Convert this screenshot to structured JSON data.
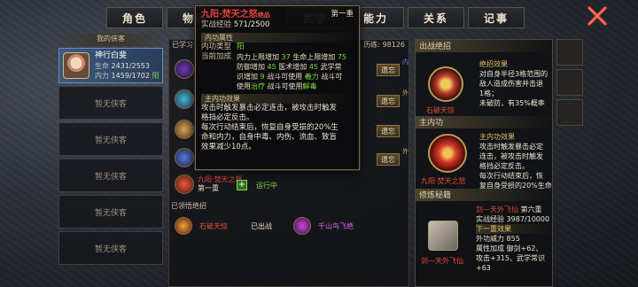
{
  "tabs": [
    "角色",
    "物品",
    "武学",
    "能力",
    "关系",
    "记事"
  ],
  "left": {
    "title": "我的侠客",
    "active_char": {
      "name": "神行白斐",
      "hp_label": "生命",
      "hp_value": "2431/2553",
      "mp_label": "内力",
      "mp_value": "1459/1702",
      "mp_tag": "阳"
    },
    "empty_slot": "暂无侠客",
    "empty_count": 5
  },
  "mid": {
    "header_left": "已学习",
    "header_right": "历练: 98126",
    "forget_label": "遗忘",
    "skills": [
      {
        "note": "内"
      },
      {
        "note": "外"
      },
      {
        "note": ""
      },
      {
        "note": "外"
      },
      {
        "note": ""
      }
    ],
    "active_skill": {
      "name": "九阳·焚天之怒",
      "level": "第一重",
      "status": "运行中"
    },
    "learned_title": "已领悟绝招",
    "learned": [
      {
        "name": "石破天惊",
        "status": "已出战"
      },
      {
        "name": "千山鸟飞绝",
        "status": ""
      }
    ]
  },
  "tooltip": {
    "title": "九阳·焚天之怒",
    "title_tag": "绝品",
    "level": "第一重",
    "exp_label": "实战经验",
    "exp_value": "571/2500",
    "attr_title": "内功属性",
    "type_label": "内功类型",
    "type_value": "阳",
    "bonus_label": "当前加成",
    "bonus_lines": [
      {
        "text": "内力上限增加",
        "val": "37",
        "text2": "生命上限增加",
        "val2": "75"
      },
      {
        "text": "防御增加",
        "val": "45",
        "text2": "医术增加",
        "val2": "45",
        "text3": "武学常"
      },
      {
        "text": "识增加",
        "val": "9",
        "text2": "战斗可使用",
        "val2": "羲力",
        "text3": "战斗可"
      },
      {
        "text": "使用",
        "val": "治疗",
        "text2": "战斗可使用",
        "val2": "解毒",
        "text3": ""
      }
    ],
    "effect_title": "主内功效果",
    "effect_lines": [
      "攻击时触发暴击必定连击，被攻击时触发",
      "格挡必定反击。",
      "每次行动结束后，恢复自身受损的20%生",
      "命和内力，自身中毒、内伤、流血、致盲",
      "效果减少10点。"
    ]
  },
  "right": {
    "section1": "出战绝招",
    "skill1_name": "石破天惊",
    "skill1_effect_title": "绝招效果",
    "skill1_effect": [
      "对自身半径3格范围的",
      "敌人造成伤害并击退",
      "1格；",
      "未破防，有35%概率"
    ],
    "section2": "主内功",
    "skill2_name": "九阳·焚天之怒",
    "skill2_effect_title": "主内功效果",
    "skill2_effect": [
      "攻击时触发暴击必定",
      "连击，被攻击时触发",
      "格挡必定反击。",
      "每次行动结束后，恢",
      "复自身受损的20%生命"
    ],
    "section3": "修炼秘籍",
    "book_name": "剑—天外飞仙",
    "book_level": "第六重",
    "book_exp_label": "实战经验",
    "book_exp_value": "3987/10000",
    "book_next": "下一重效果",
    "book_power_label": "外功威力",
    "book_power_value": "855",
    "book_attr": [
      "属性加成  御剑+62、",
      "攻击+315、武学常识",
      "+63"
    ]
  }
}
